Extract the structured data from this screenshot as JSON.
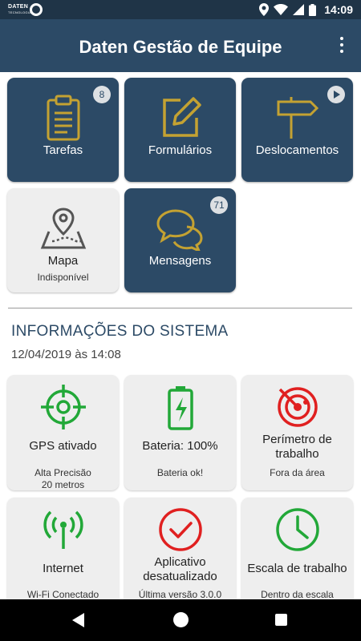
{
  "status_bar": {
    "logo": "DATEN",
    "logo_sub": "TECNOLOGIA",
    "time": "14:09",
    "icons": [
      "location-icon",
      "wifi-icon",
      "signal-icon",
      "battery-icon"
    ]
  },
  "app_bar": {
    "title": "Daten Gestão de Equipe",
    "menu_icon": "more-vert-icon"
  },
  "modules": {
    "tarefas": {
      "label": "Tarefas",
      "badge": "8",
      "icon": "clipboard-icon"
    },
    "formularios": {
      "label": "Formulários",
      "icon": "edit-icon"
    },
    "deslocamentos": {
      "label": "Deslocamentos",
      "icon": "signpost-icon",
      "action_icon": "play-icon"
    },
    "mapa": {
      "label": "Mapa",
      "sublabel": "Indisponível",
      "icon": "map-pin-icon"
    },
    "mensagens": {
      "label": "Mensagens",
      "badge": "71",
      "icon": "chat-icon"
    }
  },
  "system_info": {
    "title": "INFORMAÇÕES DO SISTEMA",
    "date": "12/04/2019 às 14:08",
    "cards": {
      "gps": {
        "label": "GPS ativado",
        "detail_1": "Alta Precisão",
        "detail_2": "20 metros",
        "icon": "crosshair-icon"
      },
      "bateria": {
        "label": "Bateria: 100%",
        "detail_1": "Bateria ok!",
        "icon": "battery-charging-icon"
      },
      "perimetro": {
        "label_1": "Perímetro de",
        "label_2": "trabalho",
        "detail_1": "Fora da área",
        "icon": "radar-icon"
      },
      "internet": {
        "label": "Internet",
        "detail_1": "Wi-Fi Conectado",
        "icon": "antenna-icon"
      },
      "aplicativo": {
        "label_1": "Aplicativo",
        "label_2": "desatualizado",
        "detail_1": "Última versão 3.0.0",
        "icon": "check-circle-icon"
      },
      "escala": {
        "label": "Escala de trabalho",
        "detail_1": "Dentro da escala",
        "icon": "clock-icon"
      }
    }
  },
  "colors": {
    "primary": "#2c4a66",
    "status_bar": "#1f3447",
    "icon_gold": "#c4a232",
    "ok_green": "#22a838",
    "alert_red": "#e02020"
  },
  "nav_bar": {
    "icons": [
      "back-icon",
      "home-icon",
      "recents-icon"
    ]
  }
}
